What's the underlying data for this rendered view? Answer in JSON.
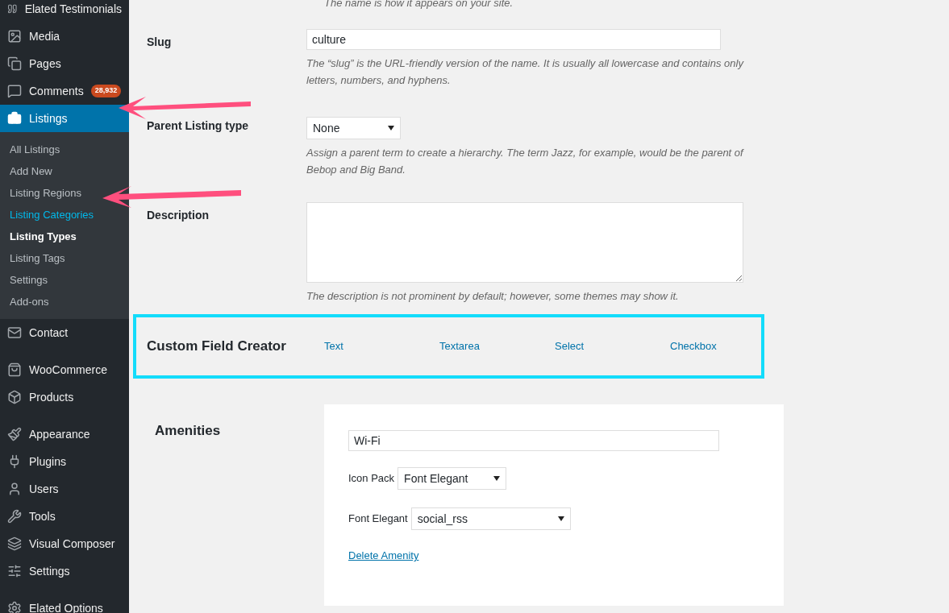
{
  "sidebar": {
    "groups": [
      {
        "items": [
          {
            "label": "Elated Testimonials",
            "selected": false
          },
          {
            "label": "Media",
            "selected": false
          },
          {
            "label": "Pages",
            "selected": false
          },
          {
            "label": "Comments",
            "selected": false,
            "badge": "28,932"
          },
          {
            "label": "Listings",
            "selected": true,
            "submenu": [
              {
                "label": "All Listings",
                "current": false,
                "hovered": false
              },
              {
                "label": "Add New",
                "current": false,
                "hovered": false
              },
              {
                "label": "Listing Regions",
                "current": false,
                "hovered": false
              },
              {
                "label": "Listing Categories",
                "current": false,
                "hovered": true
              },
              {
                "label": "Listing Types",
                "current": true,
                "hovered": false
              },
              {
                "label": "Listing Tags",
                "current": false,
                "hovered": false
              },
              {
                "label": "Settings",
                "current": false,
                "hovered": false
              },
              {
                "label": "Add-ons",
                "current": false,
                "hovered": false
              }
            ]
          },
          {
            "label": "Contact",
            "selected": false
          }
        ]
      },
      {
        "items": [
          {
            "label": "WooCommerce",
            "selected": false
          },
          {
            "label": "Products",
            "selected": false
          }
        ]
      },
      {
        "items": [
          {
            "label": "Appearance",
            "selected": false
          },
          {
            "label": "Plugins",
            "selected": false
          },
          {
            "label": "Users",
            "selected": false
          },
          {
            "label": "Tools",
            "selected": false
          },
          {
            "label": "Visual Composer",
            "selected": false
          },
          {
            "label": "Settings",
            "selected": false
          }
        ]
      },
      {
        "items": [
          {
            "label": "Elated Options",
            "selected": false
          }
        ]
      }
    ]
  },
  "form": {
    "top_hint": "The name is how it appears on your site.",
    "rows": [
      {
        "kind": "input",
        "label": "Slug",
        "value": "culture",
        "hint": "The “slug” is the URL-friendly version of the name. It is usually all lowercase and contains only letters, numbers, and hyphens."
      },
      {
        "kind": "select",
        "label": "Parent Listing type",
        "value": "None",
        "hint": "Assign a parent term to create a hierarchy. The term Jazz, for example, would be the parent of Bebop and Big Band."
      },
      {
        "kind": "textarea",
        "label": "Description",
        "value": "",
        "hint": "The description is not prominent by default; however, some themes may show it."
      }
    ]
  },
  "custom_field_creator": {
    "title": "Custom Field Creator",
    "highlighted": true,
    "links": [
      "Text",
      "Textarea",
      "Select",
      "Checkbox"
    ]
  },
  "amenities": {
    "title": "Amenities",
    "name_value": "Wi-Fi",
    "icon_pack_label": "Icon Pack",
    "icon_pack_value": "Font Elegant",
    "icon_label": "Font Elegant",
    "icon_value": "social_rss",
    "delete_link": "Delete Amenity"
  }
}
